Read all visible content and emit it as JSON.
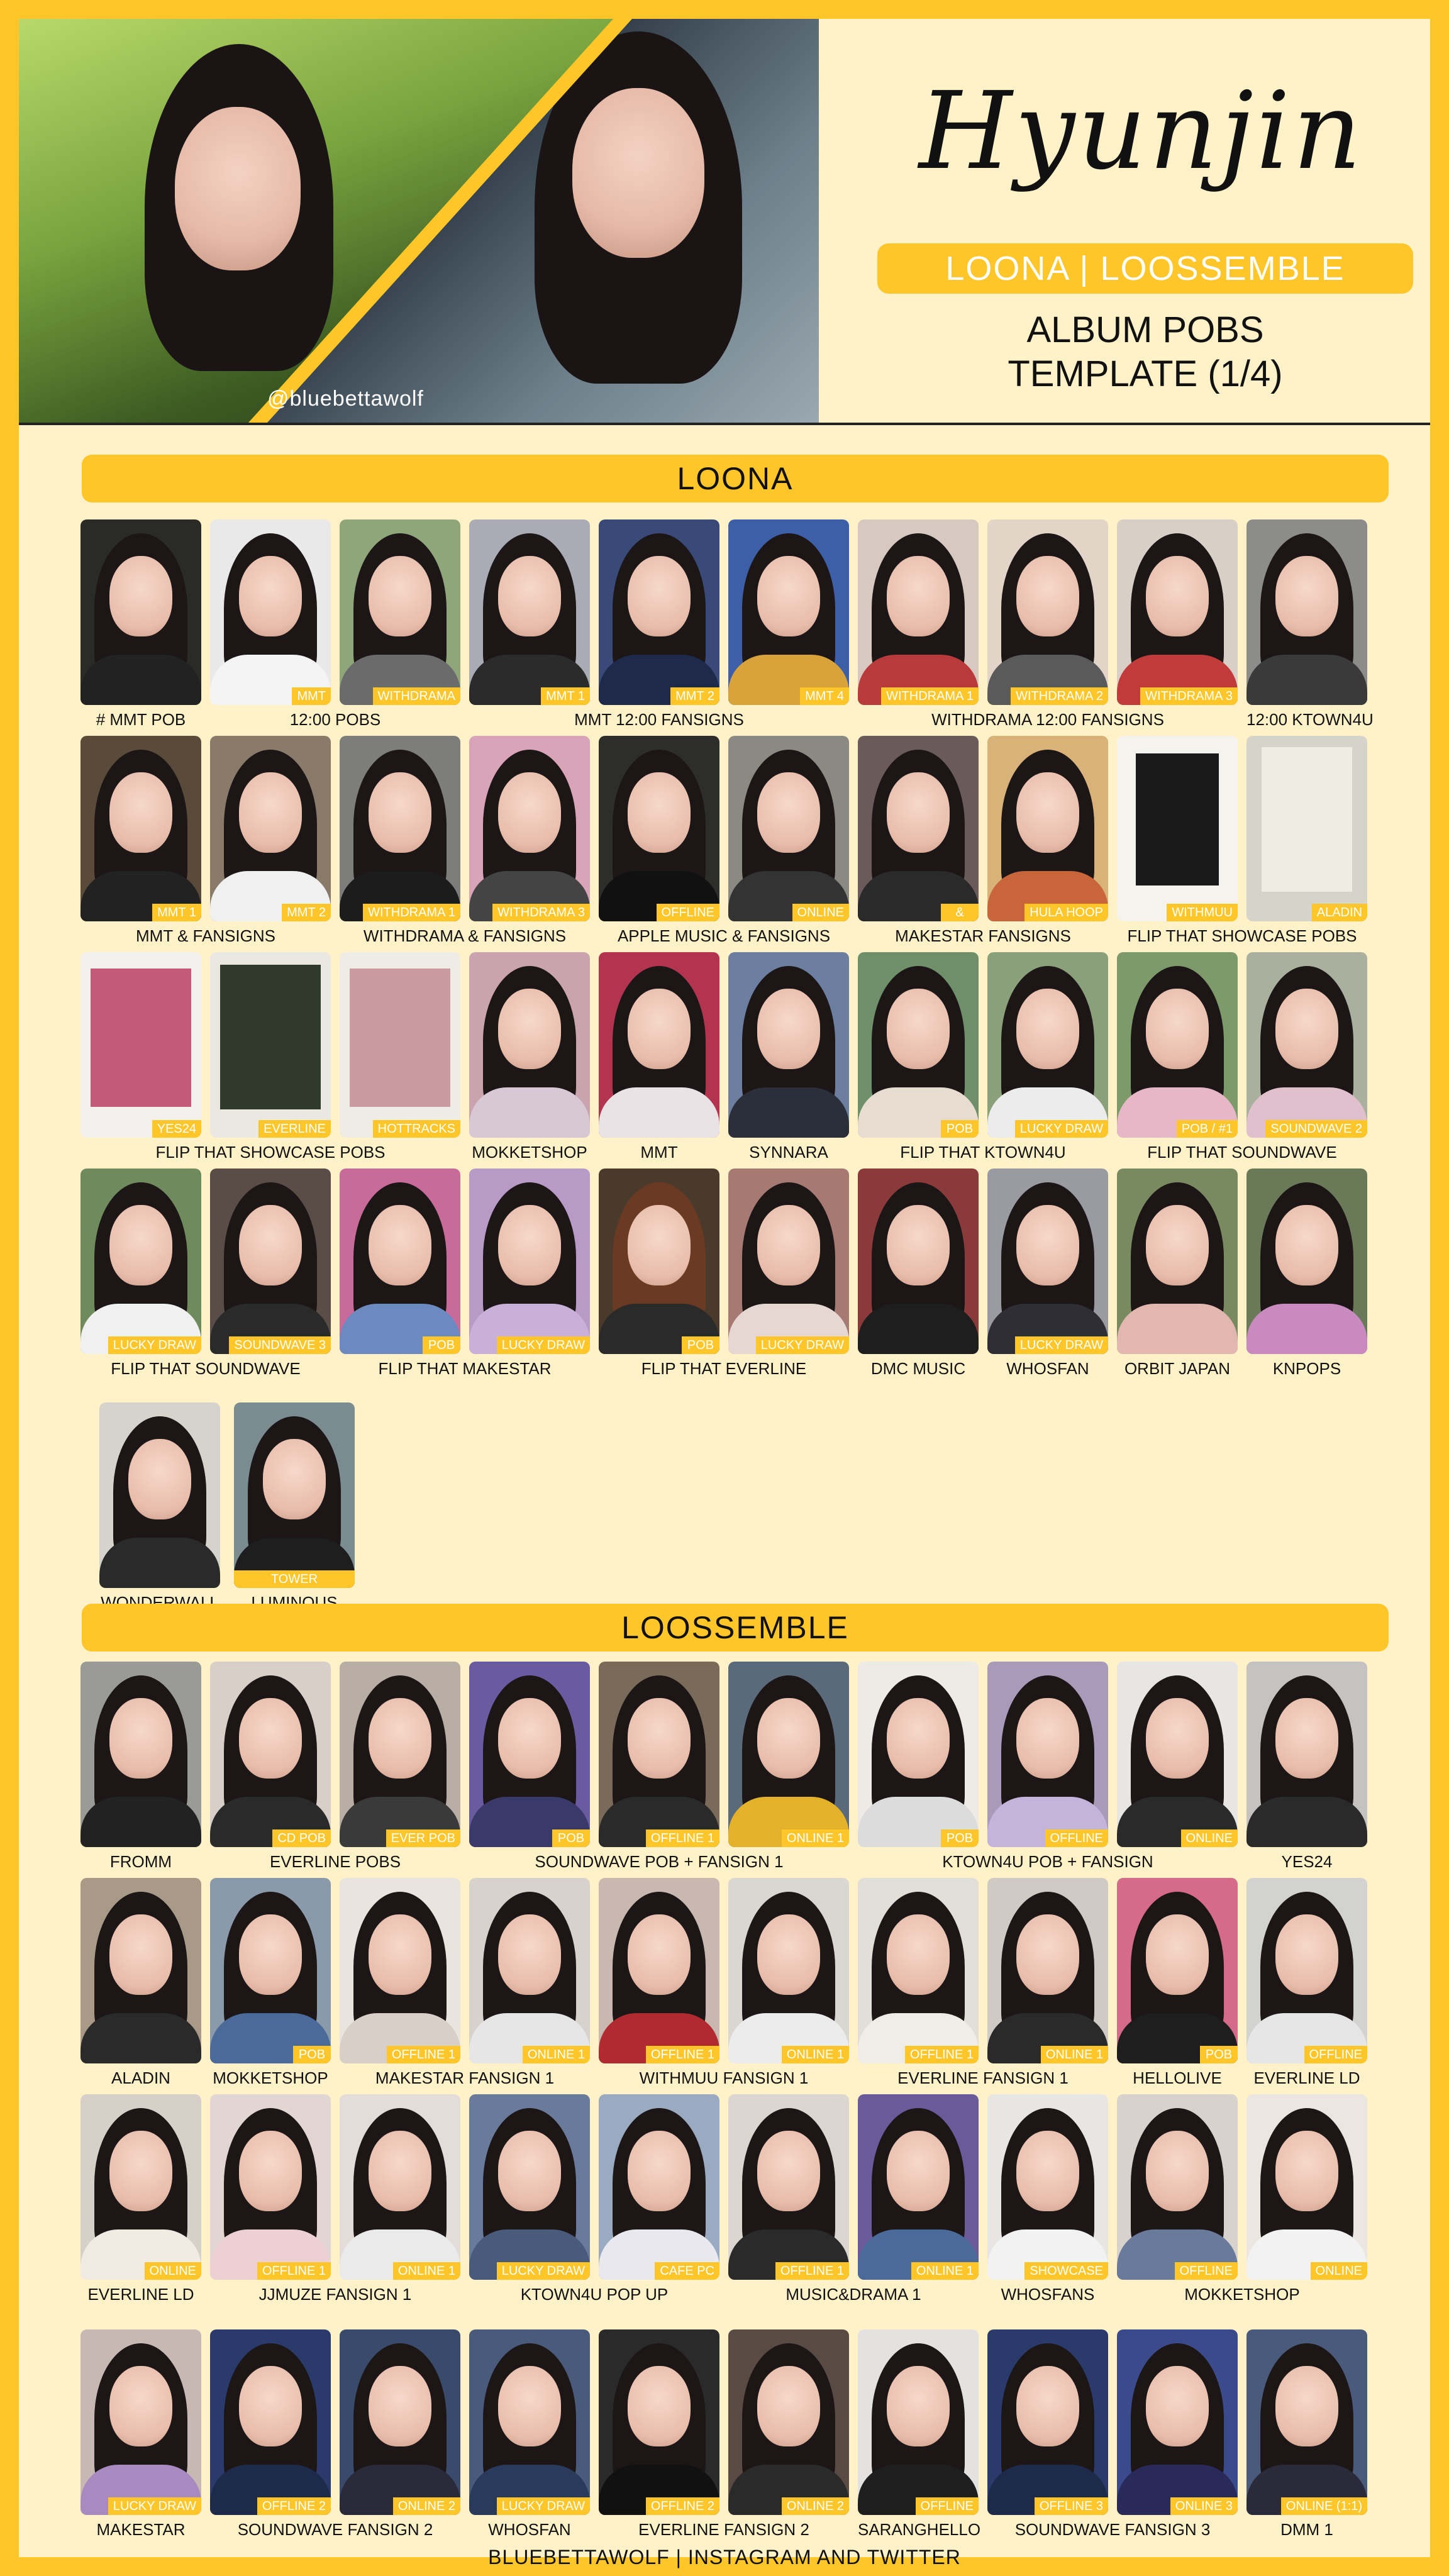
{
  "header": {
    "name": "Hyunjin",
    "groups": "LOONA | LOOSSEMBLE",
    "subtitle_line1": "ALBUM POBS",
    "subtitle_line2": "TEMPLATE (1/4)",
    "watermark": "@bluebettawolf"
  },
  "sections": {
    "loona": "LOONA",
    "loossemble": "LOOSSEMBLE"
  },
  "footer": "BLUEBETTAWOLF | INSTAGRAM AND TWITTER",
  "tags": {
    "t_mmt": "MMT",
    "t_withdrama": "WITHDRAMA",
    "t_mmt1": "MMT 1",
    "t_mmt2": "MMT 2",
    "t_mmt4": "MMT 4",
    "t_withdrama1": "WITHDRAMA 1",
    "t_withdrama2": "WITHDRAMA 2",
    "t_withdrama3": "WITHDRAMA 3",
    "t_offline": "OFFLINE",
    "t_online": "ONLINE",
    "t_amp": "&",
    "t_hulahoop": "HULA HOOP",
    "t_withmuu": "WITHMUU",
    "t_aladin": "ALADIN",
    "t_yes24": "YES24",
    "t_everline": "EVERLINE",
    "t_hottracks": "HOTTRACKS",
    "t_pob": "POB",
    "t_luckydraw": "LUCKY DRAW",
    "t_pob1": "POB / #1",
    "t_soundwave2": "SOUNDWAVE 2",
    "t_soundwave3": "SOUNDWAVE 3",
    "t_towerrecords": "TOWER RECORDS",
    "t_cdpob": "CD POB",
    "t_everpob": "EVER POB",
    "t_offline1": "OFFLINE 1",
    "t_online1": "ONLINE 1",
    "t_cafepc": "CAFE PC",
    "t_showcase": "SHOWCASE",
    "t_offline2": "OFFLINE 2",
    "t_online2": "ONLINE 2",
    "t_offline3": "OFFLINE 3",
    "t_online3": "ONLINE 3",
    "t_online11": "ONLINE (1:1)"
  },
  "captions": {
    "c1": "# MMT POB",
    "c2": "12:00 POBS",
    "c3": "MMT 12:00 FANSIGNS",
    "c4": "WITHDRAMA 12:00 FANSIGNS",
    "c5": "12:00 KTOWN4U",
    "c6": "MMT & FANSIGNS",
    "c7": "WITHDRAMA & FANSIGNS",
    "c8": "APPLE MUSIC & FANSIGNS",
    "c9": "MAKESTAR FANSIGNS",
    "c10": "FLIP THAT SHOWCASE POBS",
    "c11": "FLIP THAT SHOWCASE POBS",
    "c12": "MOKKETSHOP",
    "c13": "MMT",
    "c14": "SYNNARA",
    "c15": "FLIP THAT KTOWN4U",
    "c16": "FLIP THAT SOUNDWAVE",
    "c17": "FLIP THAT SOUNDWAVE",
    "c18": "FLIP THAT MAKESTAR",
    "c19": "FLIP THAT EVERLINE",
    "c20": "DMC MUSIC",
    "c21": "WHOSFAN",
    "c22": "ORBIT JAPAN",
    "c23": "KNPOPS",
    "c24": "WONDERWALL",
    "c25": "LUMINOUS",
    "d1": "FROMM",
    "d2": "EVERLINE POBS",
    "d3": "SOUNDWAVE POB + FANSIGN 1",
    "d4": "KTOWN4U POB + FANSIGN",
    "d5": "YES24",
    "d6": "ALADIN",
    "d7": "MOKKETSHOP",
    "d8": "MAKESTAR FANSIGN 1",
    "d9": "WITHMUU FANSIGN 1",
    "d10": "EVERLINE FANSIGN 1",
    "d11": "HELLOLIVE",
    "d12": "EVERLINE LD",
    "d13": "EVERLINE LD",
    "d14": "JJMUZE FANSIGN 1",
    "d15": "KTOWN4U POP UP",
    "d16": "MUSIC&DRAMA 1",
    "d17": "WHOSFANS",
    "d18": "MOKKETSHOP",
    "d19": "MAKESTAR",
    "d20": "SOUNDWAVE FANSIGN 2",
    "d21": "WHOSFAN",
    "d22": "EVERLINE FANSIGN 2",
    "d23": "SARANGHELLO",
    "d24": "SOUNDWAVE FANSIGN 3",
    "d25": "DMM 1"
  }
}
